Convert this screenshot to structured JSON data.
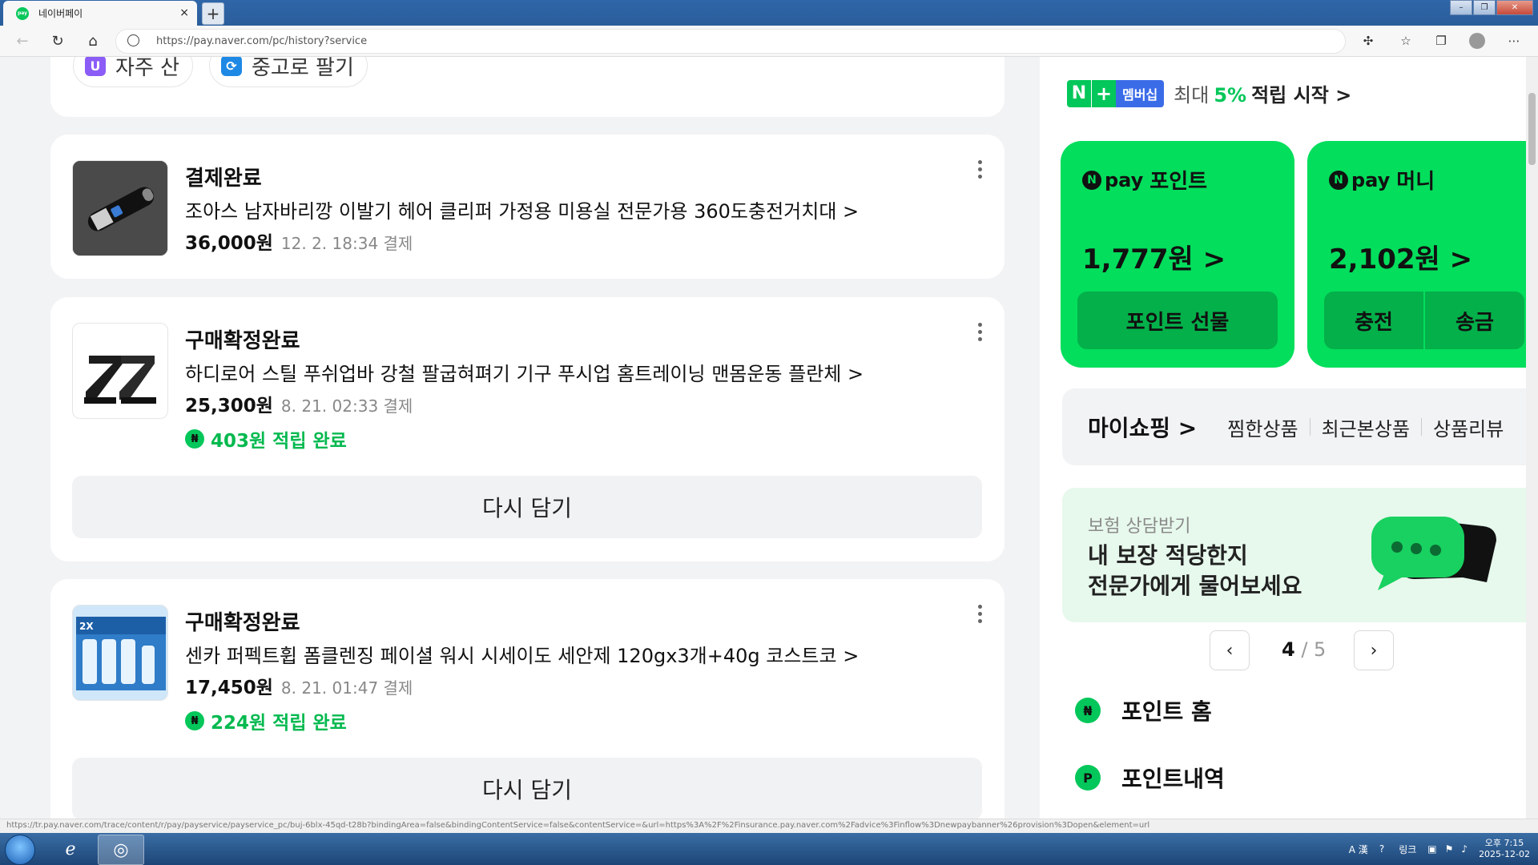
{
  "browser": {
    "tab_title": "네이버페이",
    "tab_close": "×",
    "new_tab": "+",
    "url": "https://pay.naver.com/pc/history?service",
    "window_controls": [
      "–",
      "❐",
      "✕"
    ]
  },
  "shortcuts": [
    {
      "label": "자주 산",
      "icon": "shopping-bag-icon",
      "color": "#8b5cf6"
    },
    {
      "label": "중고로 팔기",
      "icon": "recycle-icon",
      "color": "#1e88e5"
    }
  ],
  "orders": [
    {
      "status": "결제완료",
      "product": "조아스 남자바리깡 이발기 헤어 클리퍼 가정용 미용실 전문가용 360도충전거치대 >",
      "price": "36,000원",
      "date": "12. 2. 18:34 결제"
    },
    {
      "status": "구매확정완료",
      "product": "하디로어 스틸 푸쉬업바 강철 팔굽혀펴기 기구 푸시업 홈트레이닝 맨몸운동 플란체 >",
      "price": "25,300원",
      "date": "8. 21. 02:33 결제",
      "reward": "403원 적립 완료",
      "rebuy": "다시 담기"
    },
    {
      "status": "구매확정완료",
      "product": "센카 퍼펙트휩 폼클렌징 페이셜 워시 시세이도 세안제 120gx3개+40g 코스트코 >",
      "price": "17,450원",
      "date": "8. 21. 01:47 결제",
      "reward": "224원 적립 완료",
      "rebuy": "다시 담기"
    }
  ],
  "sidebar": {
    "membership": {
      "badge": "멤버십",
      "text": "최대",
      "percent": "5%",
      "action": "적립 시작 >"
    },
    "point_card": {
      "pay": "pay",
      "title": "포인트",
      "amount": "1,777원 >",
      "button": "포인트 선물"
    },
    "money_card": {
      "pay": "pay",
      "title": "머니",
      "amount": "2,102원 >",
      "charge": "충전",
      "send": "송금"
    },
    "myshopping": {
      "title": "마이쇼핑 >",
      "links": [
        "찜한상품",
        "최근본상품",
        "상품리뷰"
      ]
    },
    "banner": {
      "sub": "보험 상담받기",
      "line1": "내 보장 적당한지",
      "line2": "전문가에게 물어보세요"
    },
    "pager": {
      "current": "4",
      "sep": " / ",
      "total": "5"
    },
    "menu": [
      {
        "label": "포인트 홈",
        "icon": "₦"
      },
      {
        "label": "포인트내역",
        "icon": "P"
      }
    ]
  },
  "status_url": "https://tr.pay.naver.com/trace/content/r/pay/payservice/payservice_pc/buj-6blx-45qd-t28b?bindingArea=false&bindingContentService=false&contentService=&url=https%3A%2F%2Finsurance.pay.naver.com%2Fadvice%3Finflow%3Dnewpaybanner%26provision%3Dopen&element=url",
  "taskbar": {
    "ime": "A 漢",
    "link": "링크",
    "time": "오후 7:15",
    "date": "2025-12-02"
  },
  "colors": {
    "brand_green": "#03de5c",
    "accent_green": "#03b94f",
    "membership_blue": "#3b6ce8"
  }
}
